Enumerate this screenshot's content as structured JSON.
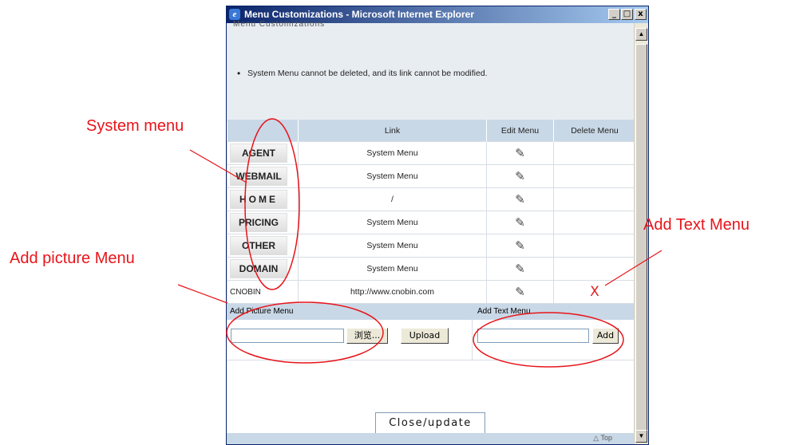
{
  "window": {
    "title": "Menu Customizations - Microsoft Internet Explorer",
    "cut_heading": "Menu Customizations",
    "min_glyph": "_",
    "max_glyph": "□",
    "close_glyph": "x",
    "scroll_up_glyph": "▲",
    "scroll_down_glyph": "▼"
  },
  "note": "System Menu cannot be deleted, and its link cannot be modified.",
  "table": {
    "headers": [
      "",
      "Link",
      "Edit Menu",
      "Delete Menu"
    ],
    "rows": [
      {
        "menu": "AGENT",
        "link": "System Menu",
        "edit_icon": "pencil-icon",
        "delete": ""
      },
      {
        "menu": "WEBMAIL",
        "link": "System Menu",
        "edit_icon": "pencil-icon",
        "delete": ""
      },
      {
        "menu": "HOME",
        "link": "/",
        "edit_icon": "pencil-icon",
        "delete": ""
      },
      {
        "menu": "PRICING",
        "link": "System Menu",
        "edit_icon": "pencil-icon",
        "delete": ""
      },
      {
        "menu": "OTHER",
        "link": "System Menu",
        "edit_icon": "pencil-icon",
        "delete": ""
      },
      {
        "menu": "DOMAIN",
        "link": "System Menu",
        "edit_icon": "pencil-icon",
        "delete": ""
      },
      {
        "menu": "CNOBIN",
        "link": "http://www.cnobin.com",
        "edit_icon": "pencil-icon",
        "delete": "X"
      }
    ]
  },
  "add_picture": {
    "label": "Add Picture Menu",
    "file_value": "",
    "browse_label": "浏览...",
    "upload_label": "Upload"
  },
  "add_text": {
    "label": "Add Text Menu",
    "value": "",
    "add_label": "Add"
  },
  "close_button": "Close/update",
  "top_link": "△ Top",
  "annotations": {
    "system_menu": "System menu",
    "add_picture_menu": "Add picture Menu",
    "add_text_menu": "Add Text Menu",
    "color": "#e8141a"
  }
}
